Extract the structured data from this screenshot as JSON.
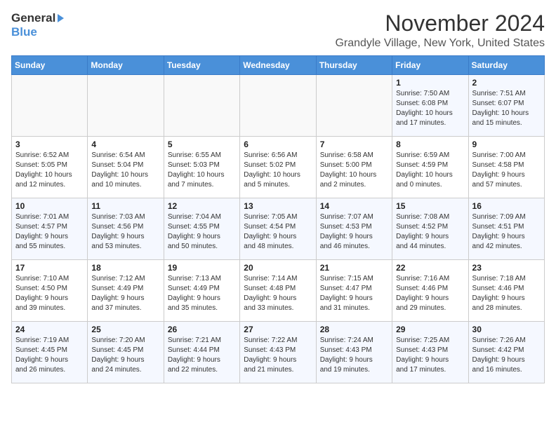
{
  "header": {
    "logo_general": "General",
    "logo_blue": "Blue",
    "month": "November 2024",
    "location": "Grandyle Village, New York, United States"
  },
  "weekdays": [
    "Sunday",
    "Monday",
    "Tuesday",
    "Wednesday",
    "Thursday",
    "Friday",
    "Saturday"
  ],
  "weeks": [
    [
      {
        "day": "",
        "info": ""
      },
      {
        "day": "",
        "info": ""
      },
      {
        "day": "",
        "info": ""
      },
      {
        "day": "",
        "info": ""
      },
      {
        "day": "",
        "info": ""
      },
      {
        "day": "1",
        "info": "Sunrise: 7:50 AM\nSunset: 6:08 PM\nDaylight: 10 hours\nand 17 minutes."
      },
      {
        "day": "2",
        "info": "Sunrise: 7:51 AM\nSunset: 6:07 PM\nDaylight: 10 hours\nand 15 minutes."
      }
    ],
    [
      {
        "day": "3",
        "info": "Sunrise: 6:52 AM\nSunset: 5:05 PM\nDaylight: 10 hours\nand 12 minutes."
      },
      {
        "day": "4",
        "info": "Sunrise: 6:54 AM\nSunset: 5:04 PM\nDaylight: 10 hours\nand 10 minutes."
      },
      {
        "day": "5",
        "info": "Sunrise: 6:55 AM\nSunset: 5:03 PM\nDaylight: 10 hours\nand 7 minutes."
      },
      {
        "day": "6",
        "info": "Sunrise: 6:56 AM\nSunset: 5:02 PM\nDaylight: 10 hours\nand 5 minutes."
      },
      {
        "day": "7",
        "info": "Sunrise: 6:58 AM\nSunset: 5:00 PM\nDaylight: 10 hours\nand 2 minutes."
      },
      {
        "day": "8",
        "info": "Sunrise: 6:59 AM\nSunset: 4:59 PM\nDaylight: 10 hours\nand 0 minutes."
      },
      {
        "day": "9",
        "info": "Sunrise: 7:00 AM\nSunset: 4:58 PM\nDaylight: 9 hours\nand 57 minutes."
      }
    ],
    [
      {
        "day": "10",
        "info": "Sunrise: 7:01 AM\nSunset: 4:57 PM\nDaylight: 9 hours\nand 55 minutes."
      },
      {
        "day": "11",
        "info": "Sunrise: 7:03 AM\nSunset: 4:56 PM\nDaylight: 9 hours\nand 53 minutes."
      },
      {
        "day": "12",
        "info": "Sunrise: 7:04 AM\nSunset: 4:55 PM\nDaylight: 9 hours\nand 50 minutes."
      },
      {
        "day": "13",
        "info": "Sunrise: 7:05 AM\nSunset: 4:54 PM\nDaylight: 9 hours\nand 48 minutes."
      },
      {
        "day": "14",
        "info": "Sunrise: 7:07 AM\nSunset: 4:53 PM\nDaylight: 9 hours\nand 46 minutes."
      },
      {
        "day": "15",
        "info": "Sunrise: 7:08 AM\nSunset: 4:52 PM\nDaylight: 9 hours\nand 44 minutes."
      },
      {
        "day": "16",
        "info": "Sunrise: 7:09 AM\nSunset: 4:51 PM\nDaylight: 9 hours\nand 42 minutes."
      }
    ],
    [
      {
        "day": "17",
        "info": "Sunrise: 7:10 AM\nSunset: 4:50 PM\nDaylight: 9 hours\nand 39 minutes."
      },
      {
        "day": "18",
        "info": "Sunrise: 7:12 AM\nSunset: 4:49 PM\nDaylight: 9 hours\nand 37 minutes."
      },
      {
        "day": "19",
        "info": "Sunrise: 7:13 AM\nSunset: 4:49 PM\nDaylight: 9 hours\nand 35 minutes."
      },
      {
        "day": "20",
        "info": "Sunrise: 7:14 AM\nSunset: 4:48 PM\nDaylight: 9 hours\nand 33 minutes."
      },
      {
        "day": "21",
        "info": "Sunrise: 7:15 AM\nSunset: 4:47 PM\nDaylight: 9 hours\nand 31 minutes."
      },
      {
        "day": "22",
        "info": "Sunrise: 7:16 AM\nSunset: 4:46 PM\nDaylight: 9 hours\nand 29 minutes."
      },
      {
        "day": "23",
        "info": "Sunrise: 7:18 AM\nSunset: 4:46 PM\nDaylight: 9 hours\nand 28 minutes."
      }
    ],
    [
      {
        "day": "24",
        "info": "Sunrise: 7:19 AM\nSunset: 4:45 PM\nDaylight: 9 hours\nand 26 minutes."
      },
      {
        "day": "25",
        "info": "Sunrise: 7:20 AM\nSunset: 4:45 PM\nDaylight: 9 hours\nand 24 minutes."
      },
      {
        "day": "26",
        "info": "Sunrise: 7:21 AM\nSunset: 4:44 PM\nDaylight: 9 hours\nand 22 minutes."
      },
      {
        "day": "27",
        "info": "Sunrise: 7:22 AM\nSunset: 4:43 PM\nDaylight: 9 hours\nand 21 minutes."
      },
      {
        "day": "28",
        "info": "Sunrise: 7:24 AM\nSunset: 4:43 PM\nDaylight: 9 hours\nand 19 minutes."
      },
      {
        "day": "29",
        "info": "Sunrise: 7:25 AM\nSunset: 4:43 PM\nDaylight: 9 hours\nand 17 minutes."
      },
      {
        "day": "30",
        "info": "Sunrise: 7:26 AM\nSunset: 4:42 PM\nDaylight: 9 hours\nand 16 minutes."
      }
    ]
  ]
}
